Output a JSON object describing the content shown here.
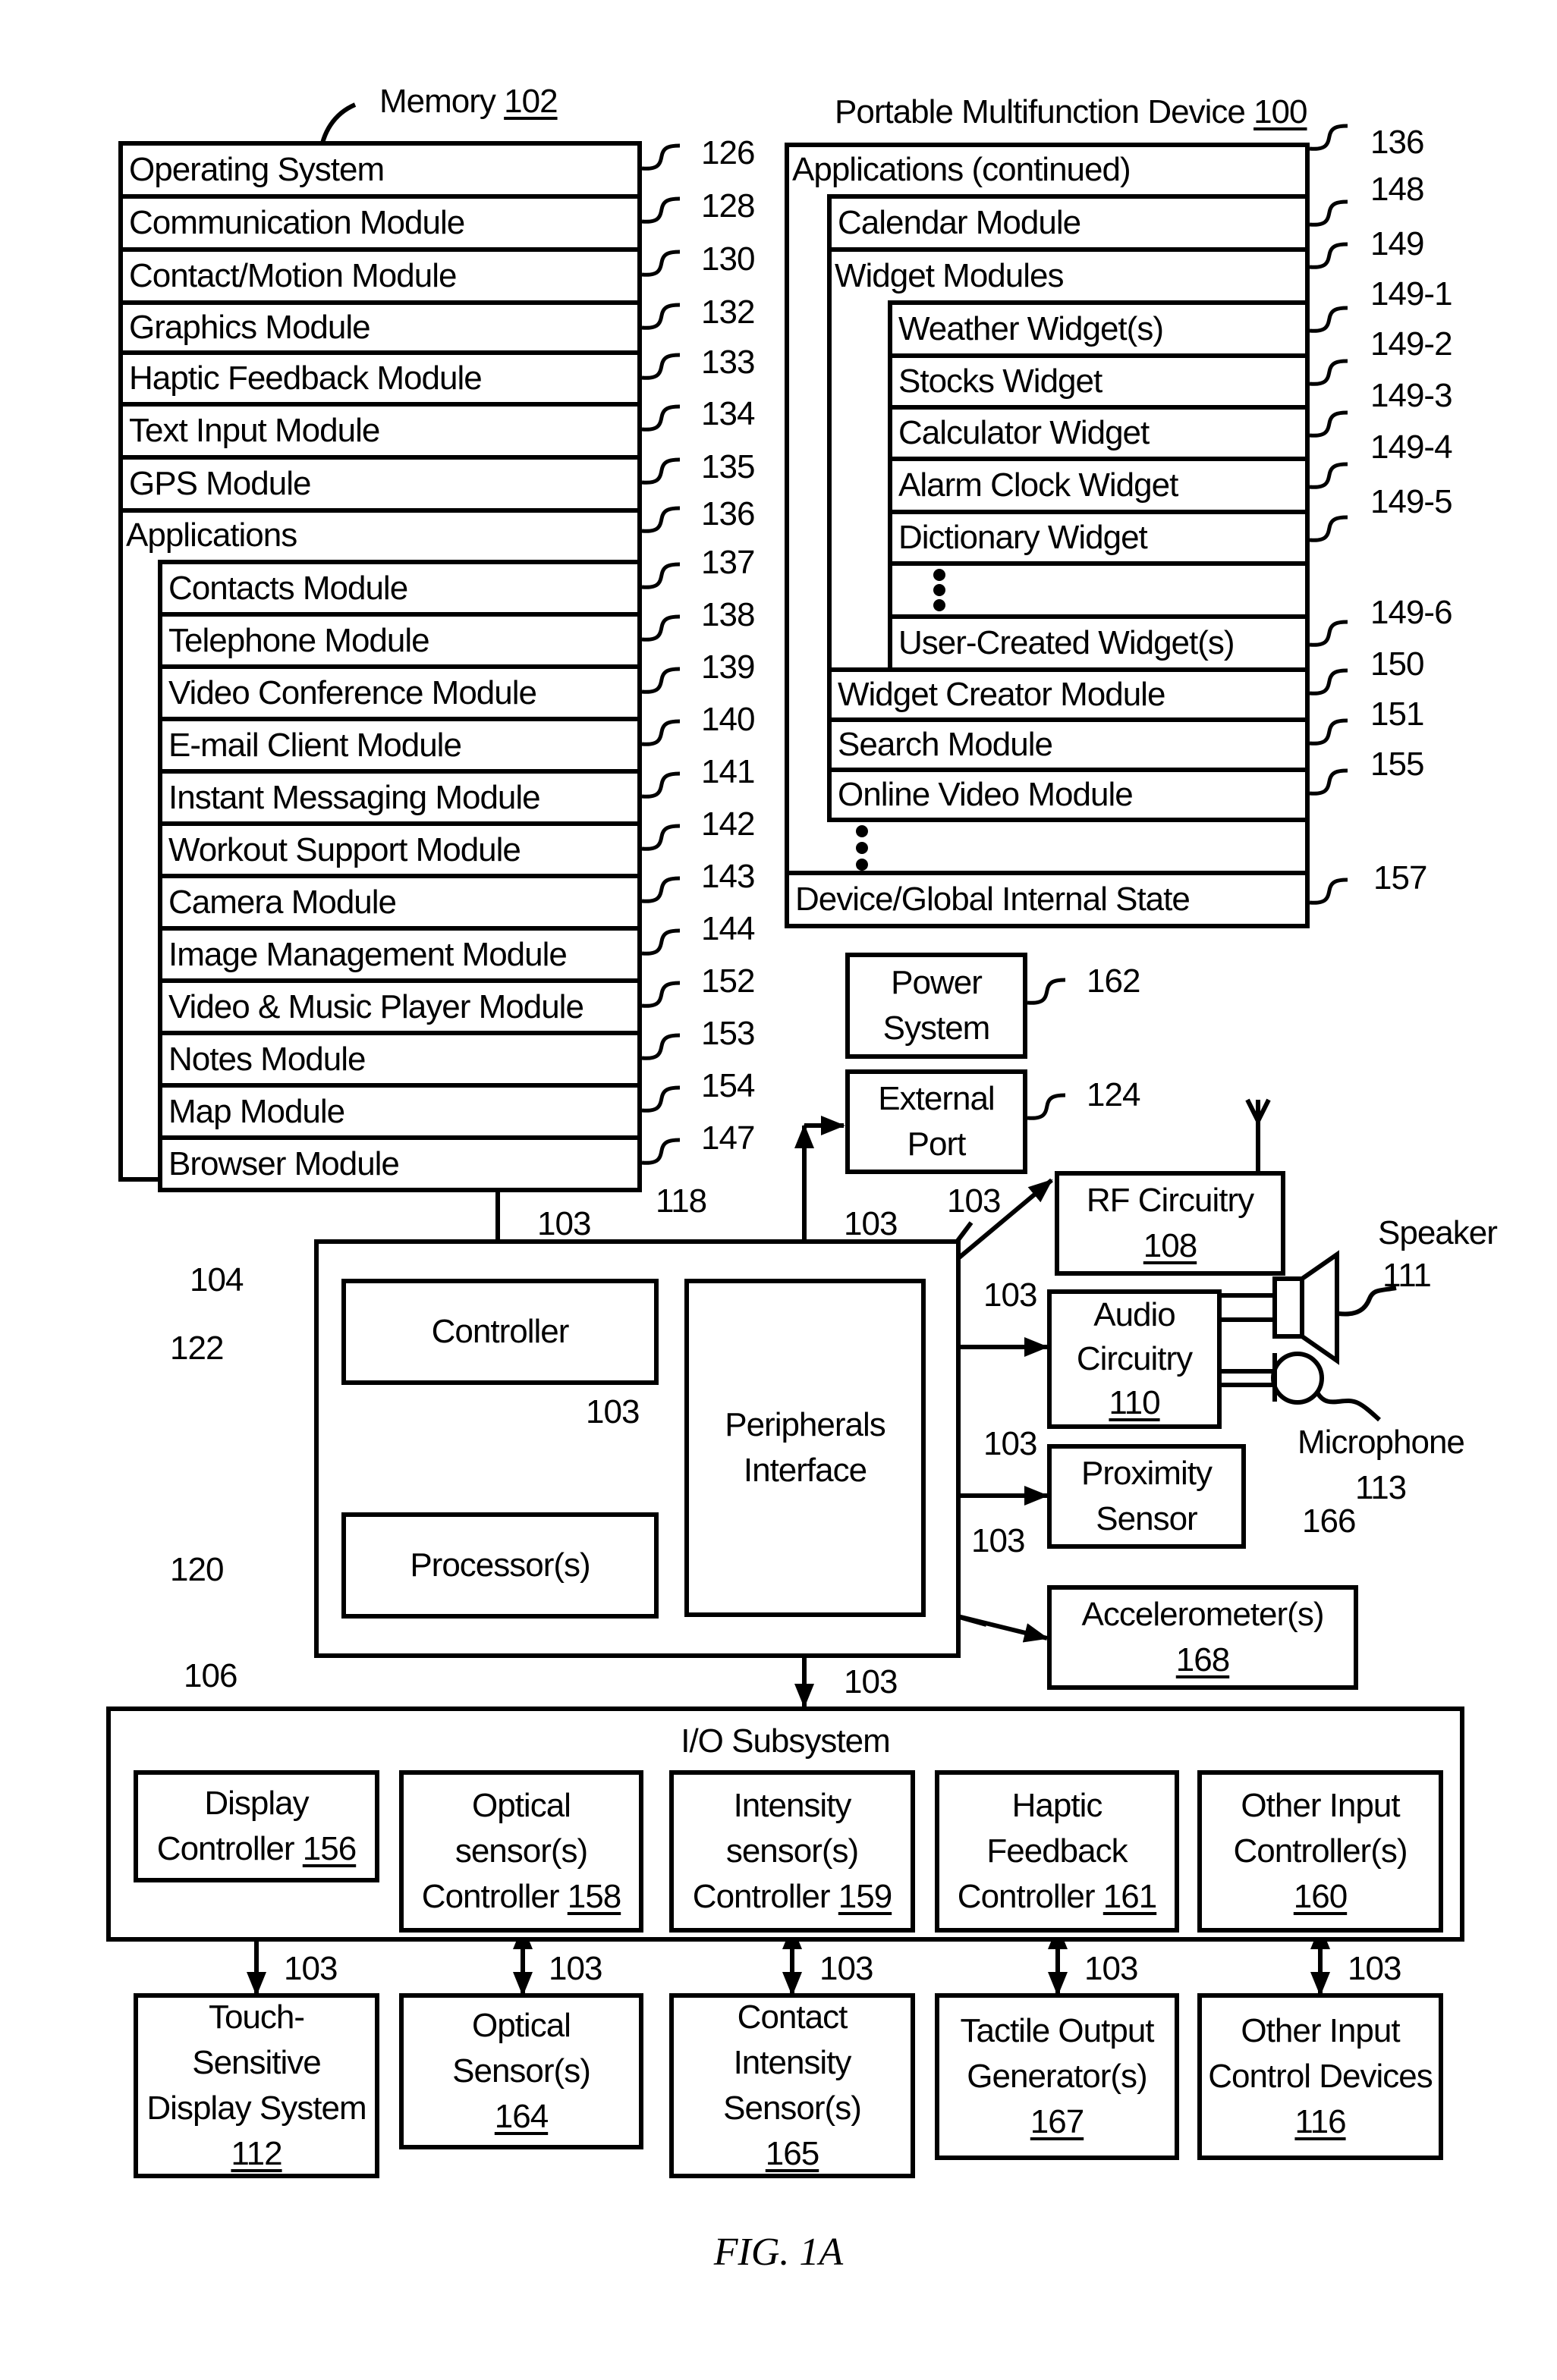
{
  "figure_label": "FIG. 1A",
  "memory": {
    "title": "Memory",
    "ref": "102",
    "rows": [
      {
        "label": "Operating System",
        "ref": "126"
      },
      {
        "label": "Communication Module",
        "ref": "128"
      },
      {
        "label": "Contact/Motion Module",
        "ref": "130"
      },
      {
        "label": "Graphics Module",
        "ref": "132"
      },
      {
        "label": "Haptic Feedback Module",
        "ref": "133"
      },
      {
        "label": "Text Input Module",
        "ref": "134"
      },
      {
        "label": "GPS Module",
        "ref": "135"
      },
      {
        "label": "Applications",
        "ref": "136"
      }
    ],
    "apps": [
      {
        "label": "Contacts Module",
        "ref": "137"
      },
      {
        "label": "Telephone Module",
        "ref": "138"
      },
      {
        "label": "Video Conference Module",
        "ref": "139"
      },
      {
        "label": "E-mail Client Module",
        "ref": "140"
      },
      {
        "label": "Instant Messaging Module",
        "ref": "141"
      },
      {
        "label": "Workout Support Module",
        "ref": "142"
      },
      {
        "label": "Camera Module",
        "ref": "143"
      },
      {
        "label": "Image Management Module",
        "ref": "144"
      },
      {
        "label": "Video & Music Player Module",
        "ref": "152"
      },
      {
        "label": "Notes Module",
        "ref": "153"
      },
      {
        "label": "Map Module",
        "ref": "154"
      },
      {
        "label": "Browser Module",
        "ref": "147"
      }
    ]
  },
  "device": {
    "title": "Portable Multifunction Device",
    "ref": "100",
    "apps_continued": {
      "label": "Applications (continued)",
      "ref": "136"
    },
    "calendar": {
      "label": "Calendar Module",
      "ref": "148"
    },
    "widgets": {
      "label": "Widget Modules",
      "ref": "149"
    },
    "widget_items": [
      {
        "label": "Weather Widget(s)",
        "ref": "149-1"
      },
      {
        "label": "Stocks Widget",
        "ref": "149-2"
      },
      {
        "label": "Calculator Widget",
        "ref": "149-3"
      },
      {
        "label": "Alarm Clock Widget",
        "ref": "149-4"
      },
      {
        "label": "Dictionary Widget",
        "ref": "149-5"
      },
      {
        "label": "User-Created Widget(s)",
        "ref": "149-6"
      }
    ],
    "more_modules": [
      {
        "label": "Widget Creator Module",
        "ref": "150"
      },
      {
        "label": "Search Module",
        "ref": "151"
      },
      {
        "label": "Online Video Module",
        "ref": "155"
      }
    ],
    "state": {
      "label": "Device/Global Internal State",
      "ref": "157"
    }
  },
  "power": {
    "line1": "Power",
    "line2": "System",
    "ref": "162"
  },
  "port": {
    "line1": "External",
    "line2": "Port",
    "ref": "124"
  },
  "bus_ref": "103",
  "chip": {
    "ref": "104",
    "controller": "Controller",
    "controller_ref": "122",
    "processor": "Processor(s)",
    "processor_ref": "120",
    "peripherals_line1": "Peripherals",
    "peripherals_line2": "Interface",
    "peripherals_ref": "118"
  },
  "rf": {
    "line1": "RF Circuitry",
    "num": "108"
  },
  "audio": {
    "line1": "Audio",
    "line2": "Circuitry",
    "num": "110"
  },
  "speaker": {
    "label": "Speaker",
    "ref": "111"
  },
  "microphone": {
    "label": "Microphone",
    "ref": "113"
  },
  "proximity": {
    "line1": "Proximity",
    "line2": "Sensor",
    "ref": "166"
  },
  "accel": {
    "line1": "Accelerometer(s)",
    "num": "168"
  },
  "io": {
    "title": "I/O Subsystem",
    "ref": "106",
    "controllers": [
      {
        "lines": [
          "Display",
          "Controller"
        ],
        "num": "156"
      },
      {
        "lines": [
          "Optical",
          "sensor(s)",
          "Controller"
        ],
        "num": "158"
      },
      {
        "lines": [
          "Intensity",
          "sensor(s)",
          "Controller"
        ],
        "num": "159"
      },
      {
        "lines": [
          "Haptic",
          "Feedback",
          "Controller"
        ],
        "num": "161"
      },
      {
        "lines": [
          "Other Input",
          "Controller(s)"
        ],
        "num": "160"
      }
    ]
  },
  "devices": [
    {
      "lines": [
        "Touch-",
        "Sensitive",
        "Display System"
      ],
      "num": "112"
    },
    {
      "lines": [
        "Optical",
        "Sensor(s)"
      ],
      "num": "164"
    },
    {
      "lines": [
        "Contact",
        "Intensity",
        "Sensor(s)"
      ],
      "num": "165"
    },
    {
      "lines": [
        "Tactile Output",
        "Generator(s)"
      ],
      "num": "167"
    },
    {
      "lines": [
        "Other Input",
        "Control Devices"
      ],
      "num": "116"
    }
  ]
}
